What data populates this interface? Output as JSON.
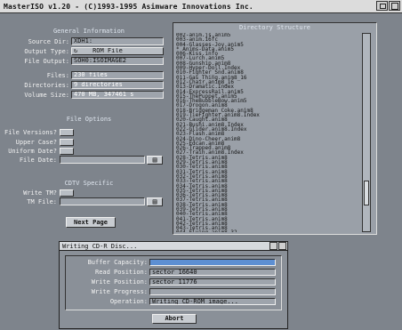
{
  "window": {
    "title": "MasterISO v1.20  -  (C)1993-1995 Asimware Innovations Inc."
  },
  "general": {
    "heading": "General Information",
    "source_dir_label": "Source Dir:",
    "source_dir_value": "XDH1:",
    "output_type_label": "Output Type:",
    "output_type_value": "ROM File",
    "file_output_label": "File Output:",
    "file_output_value": "SOH0:ISOIMAGE2",
    "files_label": "Files:",
    "files_value": "230 files",
    "directories_label": "Directories:",
    "directories_value": "9 directories",
    "volume_size_label": "Volume Size:",
    "volume_size_value": "470 MB, 347461 s"
  },
  "file_options": {
    "heading": "File Options",
    "file_versions_label": "File Versions?",
    "upper_case_label": "Upper Case?",
    "uniform_date_label": "Uniform Date?",
    "file_date_label": "File Date:",
    "file_date_value": ""
  },
  "cdtv": {
    "heading": "CDTV Specific",
    "write_tm_label": "Write TM?",
    "tm_file_label": "TM File:",
    "tm_file_value": ""
  },
  "next_page_label": "Next Page",
  "directory": {
    "heading": "Directory Structure",
    "lines": [
      "  002-anim.js.anim5",
      "   003-anim.16fc",
      "   004-Glasses-Joy.anim5",
      "* Anims-Data.anim5",
      "   006-Kiss.info",
      "   007-Lurch.anim5",
      "   008-Gunship.anim8",
      "   009-Hyper-Doll.Index",
      "   010-Fighter_Snd.anim8",
      "   011-Gas_Thing.anim8_16",
      "   012-Chair.anim8_16",
      "   013-Dramatic.Index",
      "   014-ExpressRail.anim5",
      "   015-ThePuppet.anim5",
      "   016-TheBubbleBow.anim5",
      "   017-Drogon.anim8",
      "   018-Bridgeman_Coke.anim8",
      "   019-TieFighter.anim8.Index",
      "   020-Caught.anim8",
      "   021-Bushi.anim8.Index",
      "   022-Glider.anim8.Index",
      "   023-Flash.anim8",
      "   024-Dino-Cheer.anim8",
      "   025-Edcan.anim8",
      "   026-Trapped.anim8",
      "   027-Train.anim8.Index",
      "   028-Tetris.anim8",
      "   029-Tetris.anim8",
      "   030-Tetris.anim8",
      "   031-Tetris.anim8",
      "   032-Tetris.anim8",
      "   033-Tetris.anim8",
      "   034-Tetris.anim8",
      "   035-Tetris.anim8",
      "   036-Tetris.anim8",
      "   037-Tetris.anim8",
      "   038-Tetris.anim8",
      "   039-Tetris.anim8",
      "   040-Tetris.anim8",
      "   041-Tetris.anim8",
      "   042-Tetris.anim8",
      "   043-Tetris.anim8",
      "   044-Flying.anim8_32",
      "* Anims_1.info",
      "* Disk.info"
    ],
    "scroll_position": 0.85
  },
  "writing": {
    "title": "Writing CD-R Disc...",
    "buffer_label": "Buffer Capacity:",
    "buffer_fill": 1.0,
    "read_label": "Read Position:",
    "read_value": "sector 16640",
    "write_pos_label": "Write Position:",
    "write_pos_value": "sector 11776",
    "write_progress_label": "Write Progress:",
    "write_progress_fill": 0.0,
    "operation_label": "Operation:",
    "operation_value": "Writing CD-ROM image...",
    "abort_label": "Abort"
  },
  "colors": {
    "screen_bg": "#7e848c",
    "progress": "#5d8fd2"
  }
}
